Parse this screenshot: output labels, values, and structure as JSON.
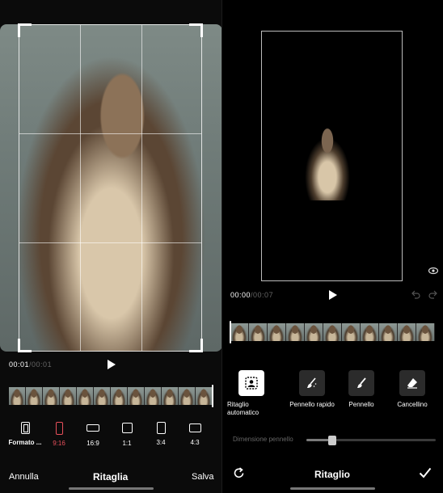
{
  "left": {
    "time_current": "00:01",
    "time_separator": "/",
    "time_total": "00:01",
    "formats": [
      {
        "label": "Formato ...",
        "active": false
      },
      {
        "label": "9:16",
        "active": true
      },
      {
        "label": "16:9",
        "active": false
      },
      {
        "label": "1:1",
        "active": false
      },
      {
        "label": "3:4",
        "active": false
      },
      {
        "label": "4:3",
        "active": false
      }
    ],
    "cancel_label": "Annulla",
    "title": "Ritaglia",
    "save_label": "Salva"
  },
  "right": {
    "time_current": "00:00",
    "time_separator": "/",
    "time_total": "00:07",
    "tools": [
      {
        "label_line1": "Ritaglio",
        "label_line2": "automatico",
        "icon": "auto-cutout-icon",
        "active": true
      },
      {
        "label_line1": "Pennello rapido",
        "label_line2": "",
        "icon": "quick-brush-icon",
        "active": false
      },
      {
        "label_line1": "Pennello",
        "label_line2": "",
        "icon": "brush-icon",
        "active": false
      },
      {
        "label_line1": "Cancellino",
        "label_line2": "",
        "icon": "eraser-icon",
        "active": false
      }
    ],
    "brush_size_label": "Dimensione pennello",
    "brush_size_level": 0.2,
    "title": "Ritaglio"
  },
  "colors": {
    "accent": "#e8505b",
    "background": "#000000"
  }
}
